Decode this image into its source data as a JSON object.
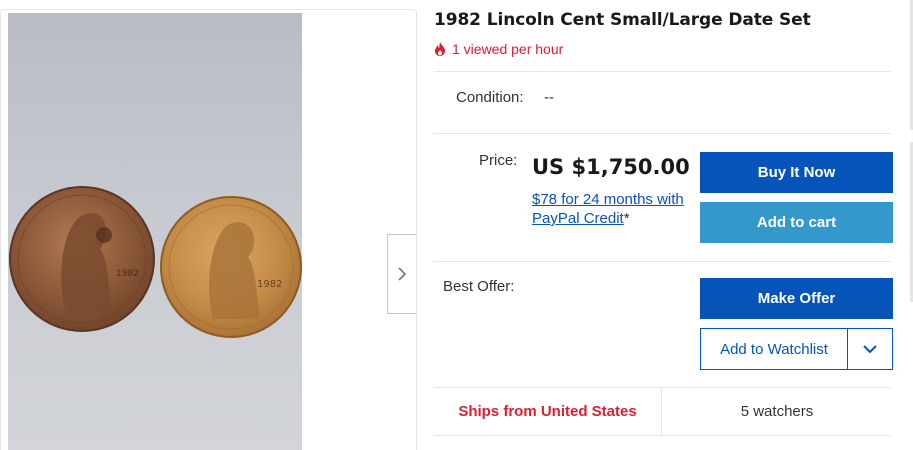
{
  "listing": {
    "title": "1982 Lincoln Cent Small/Large Date Set",
    "viewed": "1 viewed per hour"
  },
  "gallery": {
    "image_description_icon": "coin-photo",
    "coin_dates": [
      "1982",
      "1982"
    ],
    "next_icon": "chevron-right-icon"
  },
  "condition": {
    "label": "Condition:",
    "value": "--"
  },
  "price": {
    "label": "Price:",
    "value": "US $1,750.00",
    "credit_link": "$78 for 24 months with PayPal Credit",
    "credit_suffix": "*"
  },
  "actions": {
    "buy_now": "Buy It Now",
    "add_to_cart": "Add to cart",
    "make_offer": "Make Offer",
    "add_to_watchlist": "Add to Watchlist"
  },
  "best_offer": {
    "label": "Best Offer:"
  },
  "shipping": {
    "ships_from": "Ships from United States",
    "watchers": "5 watchers"
  },
  "colors": {
    "primary_blue": "#0654ba",
    "light_blue": "#3498ca",
    "alert_red": "#dd1e31"
  }
}
